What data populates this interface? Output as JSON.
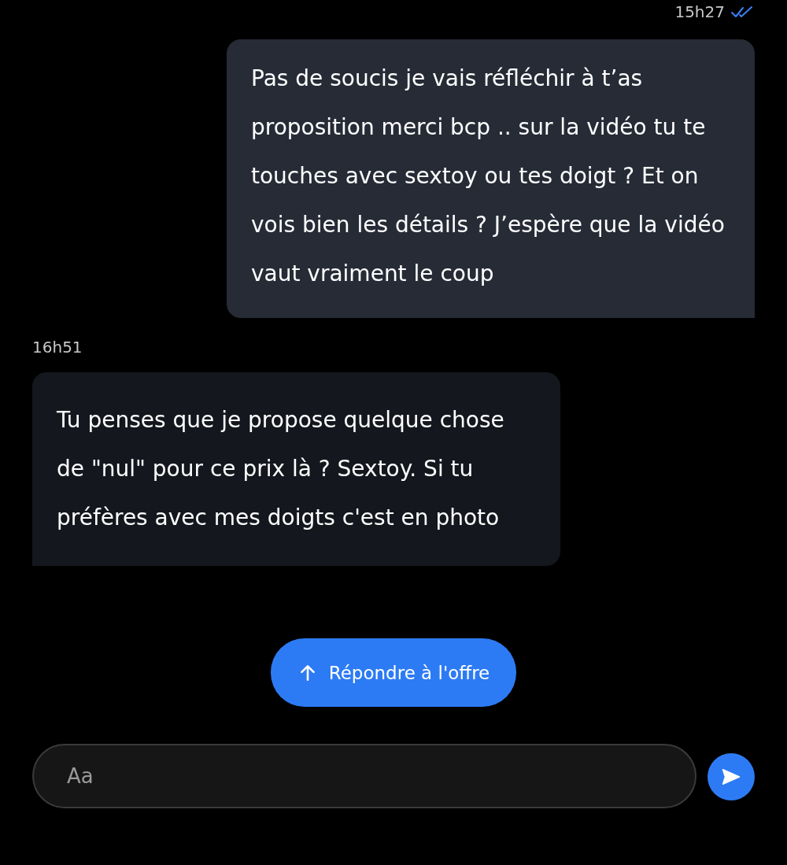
{
  "messages": [
    {
      "kind": "outgoing",
      "time": "15h27",
      "read": true,
      "text": "Pas de soucis je vais réfléchir à t’as proposition merci bcp .. sur la vidéo tu te touches avec sextoy ou tes doigt ? Et on vois bien les détails ? J’espère que la vidéo vaut vraiment le coup"
    },
    {
      "kind": "incoming",
      "time": "16h51",
      "text": "Tu penses que je propose quelque chose de \"nul\" pour ce prix là ? Sextoy. Si tu préfères avec mes doigts c'est en photo"
    }
  ],
  "offer_button": {
    "label": "Répondre à l'offre"
  },
  "composer": {
    "placeholder": "Aa"
  }
}
